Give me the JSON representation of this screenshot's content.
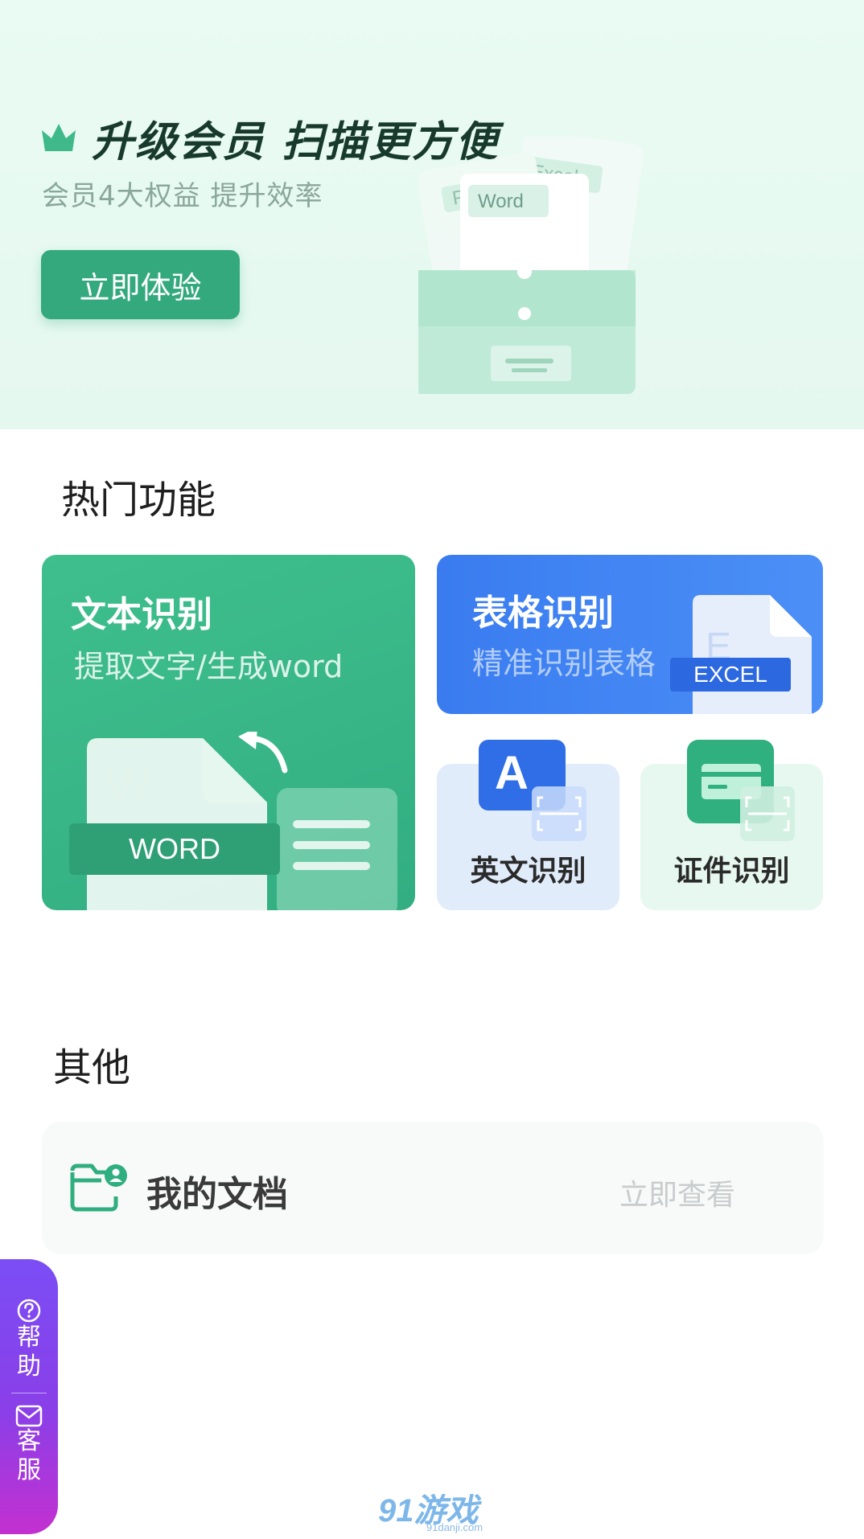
{
  "banner": {
    "title": "升级会员 扫描更方便",
    "subtitle": "会员4大权益 提升效率",
    "button_label": "立即体验",
    "illustration_labels": {
      "pdf": "PDF",
      "excel": "Excel",
      "word": "Word"
    }
  },
  "hot": {
    "title": "热门功能",
    "text_recog": {
      "title": "文本识别",
      "subtitle": "提取文字/生成word",
      "badge": "WORD"
    },
    "table_recog": {
      "title": "表格识别",
      "subtitle": "精准识别表格",
      "badge": "EXCEL"
    },
    "english_recog": {
      "label": "英文识别",
      "letter": "A"
    },
    "id_recog": {
      "label": "证件识别"
    }
  },
  "other": {
    "title": "其他",
    "my_docs": {
      "label": "我的文档",
      "action": "立即查看"
    }
  },
  "side": {
    "help": "帮助",
    "service": "客服"
  },
  "watermark": {
    "brand": "91游戏",
    "domain": "91danji.com"
  },
  "colors": {
    "brand_green": "#33a97d",
    "blue": "#3a7cf0",
    "purple": "#7b4df5"
  }
}
